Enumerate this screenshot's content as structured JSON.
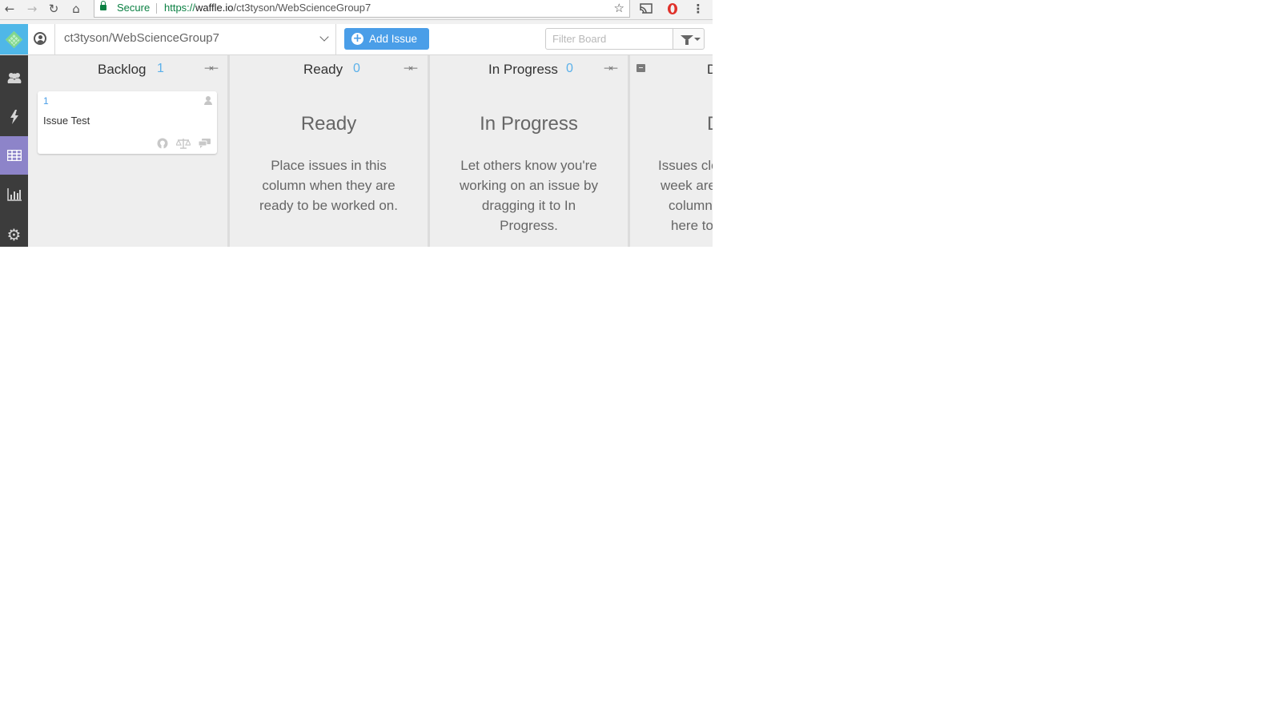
{
  "browser": {
    "back_icon": "←",
    "forward_icon": "→",
    "reload_icon": "↻",
    "home_icon": "⌂",
    "secure_label": "Secure",
    "url_scheme": "https://",
    "url_host": "waffle.io",
    "url_path": "/ct3tyson/WebScienceGroup7",
    "star_icon": "☆",
    "cast_icon": "cast-icon",
    "opera_icon": "opera-icon",
    "menu_icon": "⋮"
  },
  "header": {
    "repo_name": "ct3tyson/WebScienceGroup7",
    "add_issue_label": "Add Issue",
    "add_issue_icon": "+",
    "filter_placeholder": "Filter Board"
  },
  "sidebar": {
    "items": [
      {
        "name": "team-icon",
        "glyph": "👥"
      },
      {
        "name": "activity-icon",
        "glyph": "ϟ"
      },
      {
        "name": "board-icon",
        "glyph": "▦"
      },
      {
        "name": "metrics-icon",
        "glyph": "📊"
      },
      {
        "name": "settings-icon",
        "glyph": "⚙"
      }
    ],
    "active_index": 2
  },
  "board": {
    "columns": [
      {
        "title": "Backlog",
        "count": "1",
        "collapse_icon": "→←",
        "cards": [
          {
            "number": "1",
            "title": "Issue Test",
            "icons": [
              "github-icon",
              "estimate-icon",
              "comments-icon"
            ]
          }
        ]
      },
      {
        "title": "Ready",
        "count": "0",
        "collapse_icon": "→←",
        "empty_title": "Ready",
        "empty_desc": "Place issues in this column when they are ready to be worked on."
      },
      {
        "title": "In Progress",
        "count": "0",
        "collapse_icon": "→←",
        "empty_title": "In Progress",
        "empty_desc": "Let others know you're working on an issue by dragging it to In Progress."
      },
      {
        "title": "D",
        "empty_title": "D",
        "empty_desc_lines": [
          "Issues clo",
          "week are",
          "column",
          "here to"
        ]
      }
    ]
  },
  "colors": {
    "accent": "#4a9ee8",
    "count": "#5bb1ea",
    "sidebar": "#3c3c3c",
    "sidebar_active": "#8d84c9",
    "secure_green": "#0b8043"
  }
}
